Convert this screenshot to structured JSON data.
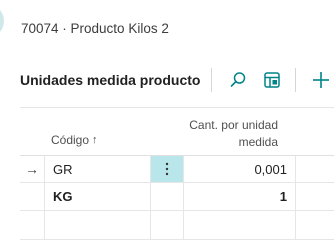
{
  "header": {
    "record_caption": "70074 · Producto Kilos 2"
  },
  "toolbar": {
    "title": "Unidades medida producto",
    "search_icon": "search-icon",
    "layout_icon": "edit-in-excel-icon",
    "add_icon": "plus-icon"
  },
  "grid": {
    "columns": {
      "code": "Código",
      "qty": "Cant. por unidad medida"
    },
    "rows": [
      {
        "code": "GR",
        "qty": "0,001",
        "selected": true
      },
      {
        "code": "KG",
        "qty": "1",
        "bold": true
      }
    ]
  },
  "colors": {
    "accent": "#008489",
    "selected_cell": "#b9e6ea"
  }
}
